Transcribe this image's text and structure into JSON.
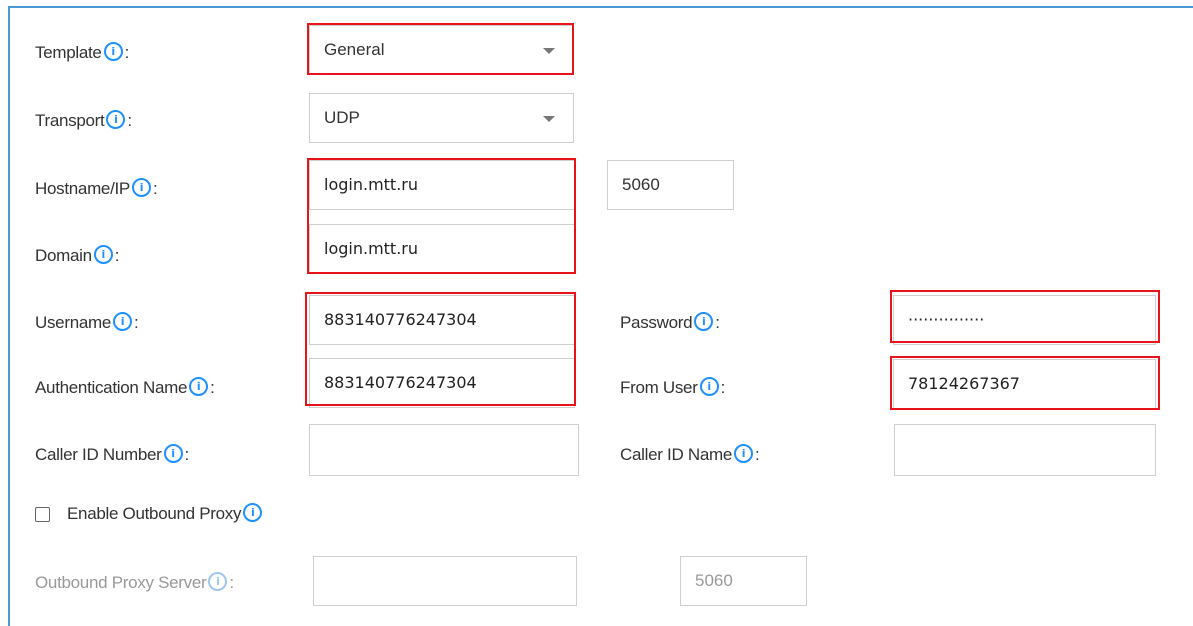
{
  "form": {
    "template": {
      "label": "Template",
      "value": "General"
    },
    "transport": {
      "label": "Transport",
      "value": "UDP"
    },
    "hostname": {
      "label": "Hostname/IP",
      "value": "login.mtt.ru",
      "port": "5060"
    },
    "domain": {
      "label": "Domain",
      "value": "login.mtt.ru"
    },
    "username": {
      "label": "Username",
      "value": "883140776247304"
    },
    "password": {
      "label": "Password",
      "value": "···············"
    },
    "auth_name": {
      "label": "Authentication Name",
      "value": "883140776247304"
    },
    "from_user": {
      "label": "From User",
      "value": "78124267367"
    },
    "caller_id_number": {
      "label": "Caller ID Number",
      "value": ""
    },
    "caller_id_name": {
      "label": "Caller ID Name",
      "value": ""
    },
    "outbound_proxy": {
      "label": "Enable Outbound Proxy",
      "checked": false
    },
    "outbound_proxy_server": {
      "label": "Outbound Proxy Server",
      "value": "",
      "port": "5060"
    }
  },
  "icons": {
    "info": "info-icon",
    "dropdown": "chevron-down-icon"
  },
  "colors": {
    "highlight": "#e8141a",
    "info": "#1e90ff",
    "frame": "#4a98d8"
  }
}
